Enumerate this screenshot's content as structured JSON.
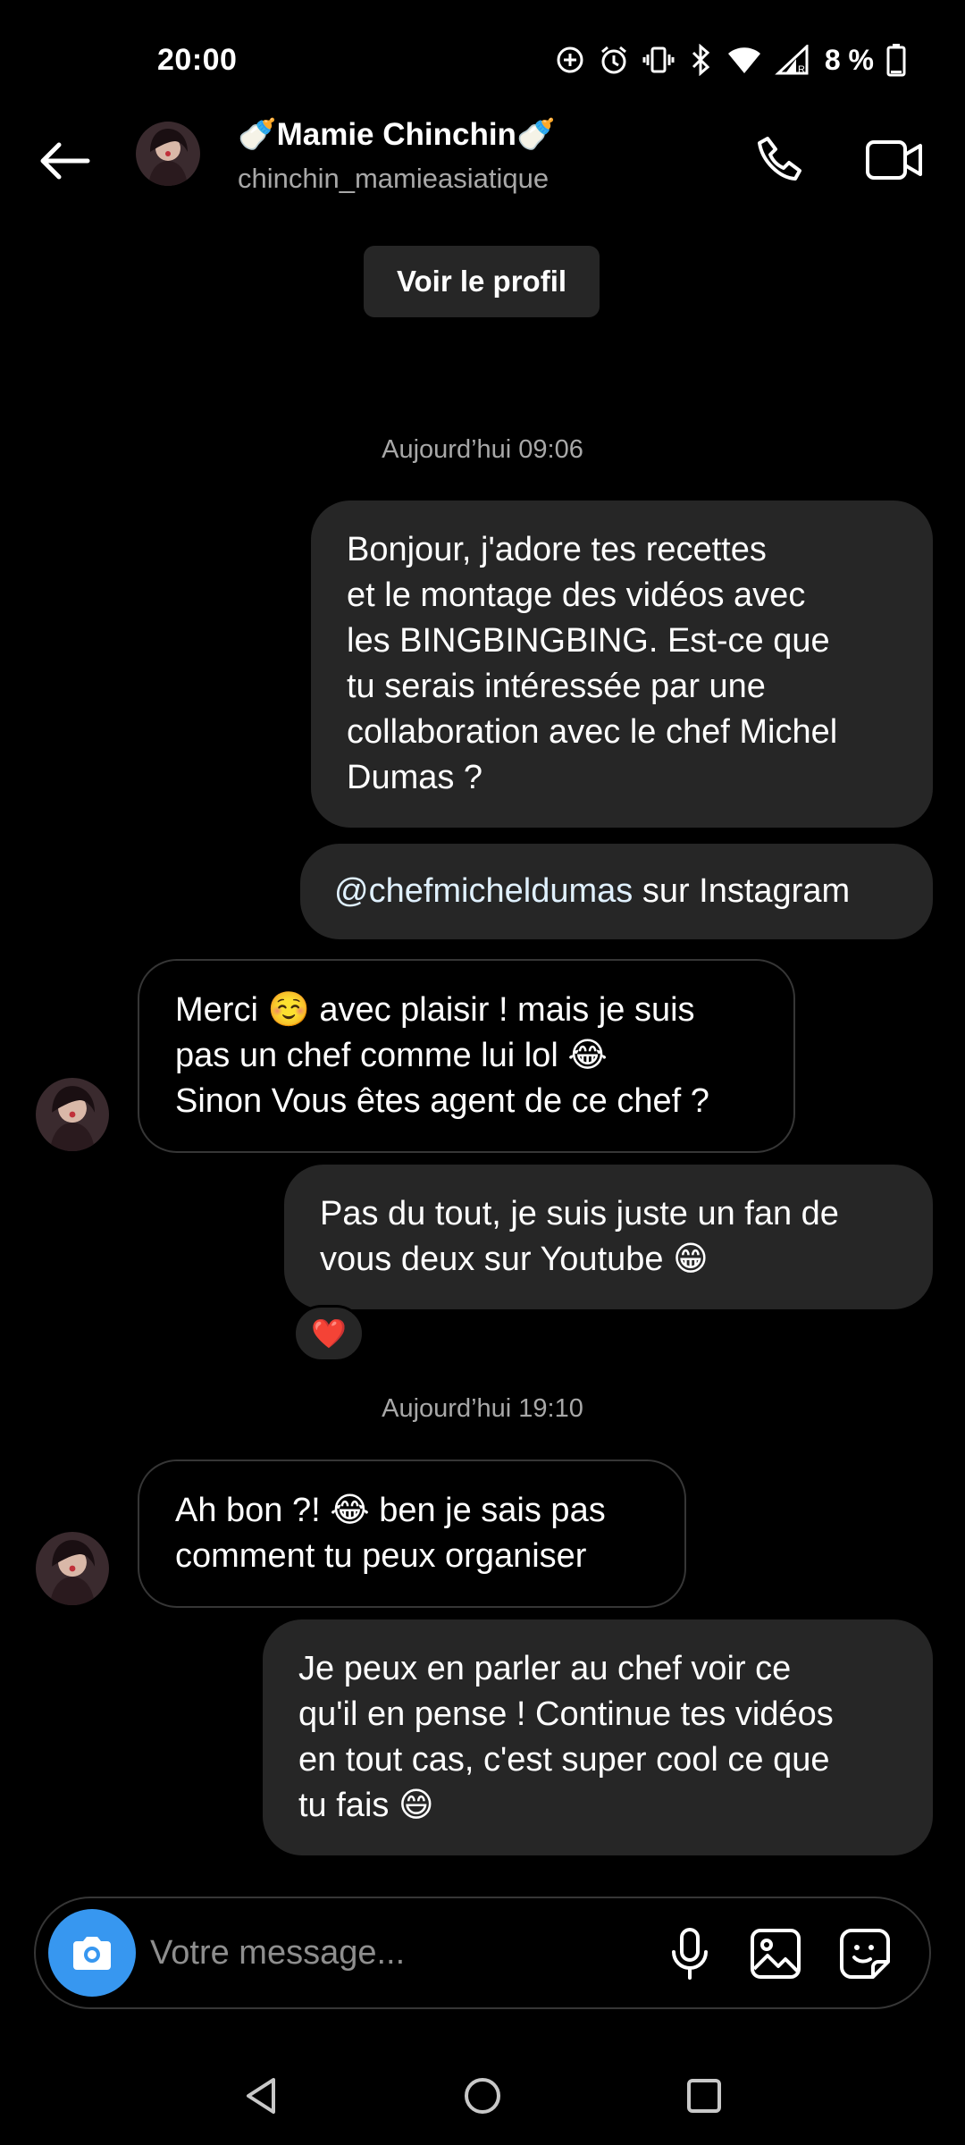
{
  "status_bar": {
    "time": "20:00",
    "battery": "8 %",
    "icons": [
      "data-saver-icon",
      "alarm-icon",
      "vibrate-icon",
      "bluetooth-icon",
      "wifi-icon",
      "signal-roaming-icon",
      "battery-low-icon"
    ]
  },
  "header": {
    "name": "🍼Mamie Chinchin🍼",
    "username": "chinchin_mamieasiatique",
    "icons": {
      "back": "arrow-left-icon",
      "call": "phone-icon",
      "video": "video-camera-icon"
    }
  },
  "profile_button": "Voir le profil",
  "timestamps": {
    "morning": "Aujourd’hui 09:06",
    "evening": "Aujourd’hui 19:10"
  },
  "messages": [
    {
      "side": "out",
      "lines": [
        "Bonjour, j'adore tes recettes",
        "et le montage des vidéos avec",
        "les BINGBINGBING. Est-ce que",
        "tu serais intéressée par une",
        "collaboration avec le chef Michel",
        "Dumas ?"
      ]
    },
    {
      "side": "out",
      "mention": "@chefmicheldumas",
      "text": " sur Instagram"
    },
    {
      "side": "in",
      "lines": [
        "Merci ☺️ avec plaisir ! mais je suis",
        "pas un chef comme lui lol 😂",
        "Sinon Vous êtes agent de ce chef ?"
      ]
    },
    {
      "side": "out",
      "lines": [
        "Pas du tout, je suis juste un fan de",
        "vous deux sur Youtube 😁"
      ],
      "reaction": "❤️"
    },
    {
      "side": "in",
      "lines": [
        "Ah bon ?! 😂 ben je sais pas",
        "comment tu peux organiser"
      ]
    },
    {
      "side": "out",
      "lines": [
        "Je peux en parler au chef voir ce",
        "qu'il en pense ! Continue tes vidéos",
        "en tout cas, c'est super cool ce que",
        "tu fais 😄"
      ]
    }
  ],
  "composer": {
    "placeholder": "Votre message...",
    "value": "",
    "icons": [
      "camera-icon",
      "microphone-icon",
      "image-icon",
      "sticker-icon"
    ],
    "accent": "#3797f0"
  },
  "nav": {
    "icons": [
      "back-triangle-icon",
      "home-circle-icon",
      "recents-square-icon"
    ]
  },
  "colors": {
    "background": "#000000",
    "bubble_out": "#262626",
    "bubble_in_border": "#363636",
    "secondary_text": "#a8a8a8"
  }
}
